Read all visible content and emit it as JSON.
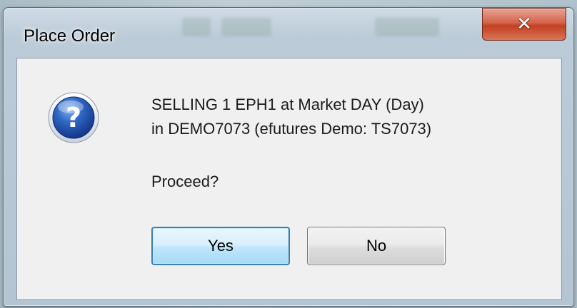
{
  "window": {
    "title": "Place Order",
    "close_glyph": "✕"
  },
  "message": {
    "line1": "SELLING 1 EPH1 at Market DAY (Day)",
    "line2": "in DEMO7073 (efutures Demo: TS7073)",
    "prompt": "Proceed?",
    "icon": "question-icon"
  },
  "buttons": {
    "yes": "Yes",
    "no": "No"
  },
  "colors": {
    "close_button": "#c3401f",
    "default_button_border": "#3c7fb1",
    "icon_blue": "#1f4fa3"
  }
}
